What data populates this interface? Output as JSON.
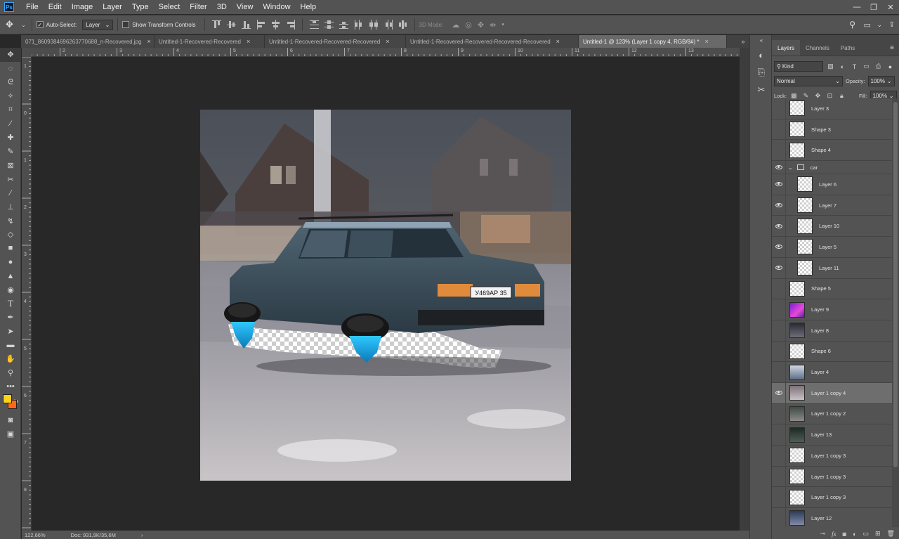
{
  "app": {
    "logo": "Ps"
  },
  "menu": [
    "File",
    "Edit",
    "Image",
    "Layer",
    "Type",
    "Select",
    "Filter",
    "3D",
    "View",
    "Window",
    "Help"
  ],
  "window_controls": [
    "—",
    "❐",
    "✕"
  ],
  "options": {
    "auto_select_label": "Auto-Select:",
    "auto_select_value": "Layer",
    "show_transform_label": "Show Transform Controls",
    "mode_3d_label": "3D Mode:"
  },
  "tabs": [
    {
      "label": "071_8609384696263770688_n-Recovered.jpg",
      "active": false
    },
    {
      "label": "Untitled-1-Recovered-Recovered",
      "active": false
    },
    {
      "label": "Untitled-1-Recovered-Recovered-Recovered",
      "active": false
    },
    {
      "label": "Untitled-1-Recovered-Recovered-Recovered-Recovered",
      "active": false
    },
    {
      "label": "Untitled-1 @ 123% (Layer 1 copy 4, RGB/8#) *",
      "active": true
    }
  ],
  "tab_close": "×",
  "tab_overflow": "»",
  "ruler_h": [
    "2",
    "3",
    "4",
    "5",
    "6",
    "7",
    "8",
    "9",
    "10",
    "11",
    "12",
    "13"
  ],
  "ruler_v": [
    "1",
    "0",
    "1",
    "2",
    "3",
    "4",
    "5",
    "6",
    "7",
    "8"
  ],
  "status": {
    "zoom": "122,66%",
    "doc": "Doc: 931,9K/35,6M",
    "arrow": "›"
  },
  "panel": {
    "tabs": [
      "Layers",
      "Channels",
      "Paths"
    ],
    "filter_kind": "Kind",
    "blend_mode": "Normal",
    "opacity_label": "Opacity:",
    "opacity_value": "100%",
    "lock_label": "Lock:",
    "fill_label": "Fill:",
    "fill_value": "100%"
  },
  "layers": [
    {
      "name": "Layer 3",
      "visible": false,
      "indent": false
    },
    {
      "name": "Shape 3",
      "visible": false,
      "indent": false
    },
    {
      "name": "Shape 4",
      "visible": false,
      "indent": false
    },
    {
      "name": "car",
      "visible": true,
      "indent": false,
      "group": true
    },
    {
      "name": "Layer 6",
      "visible": true,
      "indent": true
    },
    {
      "name": "Layer 7",
      "visible": true,
      "indent": true
    },
    {
      "name": "Layer 10",
      "visible": true,
      "indent": true
    },
    {
      "name": "Layer 5",
      "visible": true,
      "indent": true
    },
    {
      "name": "Layer 11",
      "visible": true,
      "indent": true
    },
    {
      "name": "Shape 5",
      "visible": false,
      "indent": false
    },
    {
      "name": "Layer 9",
      "visible": false,
      "indent": false
    },
    {
      "name": "Layer 8",
      "visible": false,
      "indent": false
    },
    {
      "name": "Shape 6",
      "visible": false,
      "indent": false
    },
    {
      "name": "Layer 4",
      "visible": false,
      "indent": false
    },
    {
      "name": "Layer 1 copy 4",
      "visible": true,
      "indent": false,
      "selected": true
    },
    {
      "name": "Layer 1 copy 2",
      "visible": false,
      "indent": false
    },
    {
      "name": "Layer 13",
      "visible": false,
      "indent": false
    },
    {
      "name": "Layer 1 copy 3",
      "visible": false,
      "indent": false
    },
    {
      "name": "Layer 1 copy 3",
      "visible": false,
      "indent": false
    },
    {
      "name": "Layer 1 copy 3",
      "visible": false,
      "indent": false
    },
    {
      "name": "Layer 12",
      "visible": false,
      "indent": false
    }
  ],
  "canvas_image": {
    "license_plate": "У469АР 35"
  },
  "colors": {
    "foreground": "#ffd21a",
    "background": "#ff6a1a",
    "thruster": "#2fc8ff"
  }
}
